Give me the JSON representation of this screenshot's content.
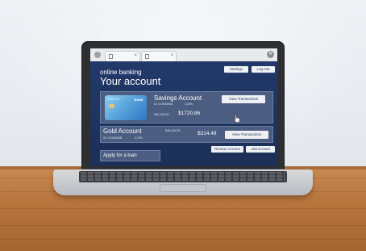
{
  "browser": {
    "tab_close_glyph": "×",
    "window_close_glyph": "✕"
  },
  "header": {
    "settings_label": "Settings",
    "logout_label": "Log Out"
  },
  "brand": {
    "small": "online banking",
    "title": "Your account"
  },
  "card": {
    "label": "Platinum",
    "brand": "BANK"
  },
  "accounts": [
    {
      "name": "Savings Account",
      "id_text": "ID: 01784596A",
      "rate": "3.28%",
      "balance_label": "BALANCE:",
      "balance": "$1720.86",
      "action_label": "View Transactions"
    },
    {
      "name": "Gold Account",
      "id_text": "ID: 01163598B",
      "rate": "0.15%",
      "balance_label": "BALANCE:",
      "balance": "$314.48",
      "action_label": "View Transactions"
    }
  ],
  "actions": {
    "remove_label": "Remove Account",
    "add_label": "Add Account",
    "loan_label": "Apply for a loan"
  },
  "colors": {
    "screen_bg": "#1f3358",
    "panel": "#4b5d80",
    "table_wood": "#b8763f"
  }
}
